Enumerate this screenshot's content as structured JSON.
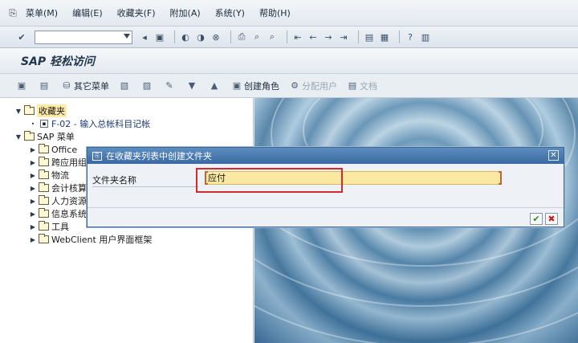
{
  "menubar": {
    "items": [
      "菜单(M)",
      "编辑(E)",
      "收藏夹(F)",
      "附加(A)",
      "系统(Y)",
      "帮助(H)"
    ]
  },
  "toolbar": {
    "command_field_value": ""
  },
  "title": {
    "text": "SAP 轻松访问"
  },
  "apptoolbar": {
    "other_menu_label": "其它菜单",
    "create_role_label": "创建角色",
    "assign_user_label": "分配用户",
    "documentation_label": "文档"
  },
  "tree": {
    "favorites_label": "收藏夹",
    "favorite_item_label": "F-02 - 输入总帐科目记帐",
    "sap_menu_label": "SAP 菜单",
    "folders": [
      "Office",
      "跨应用组",
      "物流",
      "会计核算",
      "人力资源",
      "信息系统",
      "工具",
      "WebClient 用户界面框架"
    ]
  },
  "dialog": {
    "title": "在收藏夹列表中创建文件夹",
    "field_label": "文件夹名称",
    "field_value": "应付"
  },
  "colors": {
    "dialog_title_bg": "#3a6aa2",
    "input_bg": "#fbe9a3",
    "highlight_box": "#d22b2b"
  }
}
